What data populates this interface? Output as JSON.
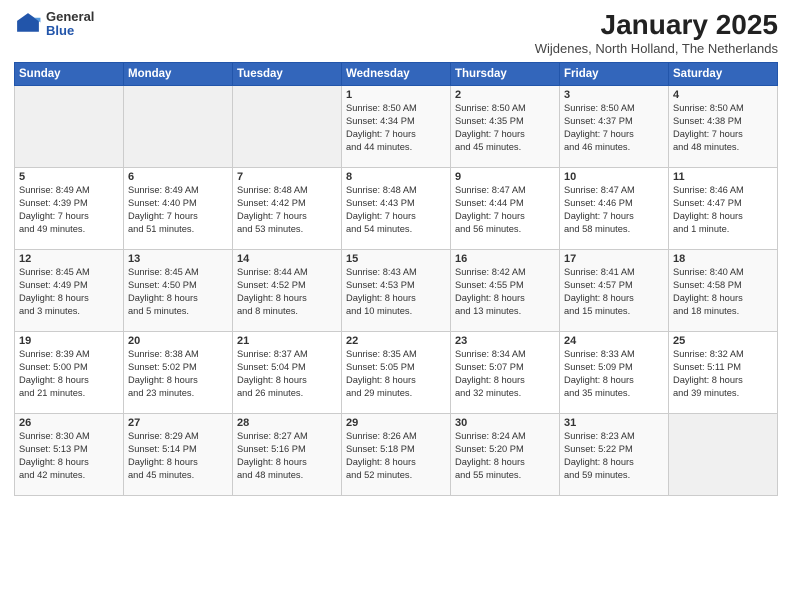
{
  "logo": {
    "general": "General",
    "blue": "Blue"
  },
  "title": "January 2025",
  "location": "Wijdenes, North Holland, The Netherlands",
  "weekdays": [
    "Sunday",
    "Monday",
    "Tuesday",
    "Wednesday",
    "Thursday",
    "Friday",
    "Saturday"
  ],
  "weeks": [
    [
      {
        "day": "",
        "info": ""
      },
      {
        "day": "",
        "info": ""
      },
      {
        "day": "",
        "info": ""
      },
      {
        "day": "1",
        "info": "Sunrise: 8:50 AM\nSunset: 4:34 PM\nDaylight: 7 hours\nand 44 minutes."
      },
      {
        "day": "2",
        "info": "Sunrise: 8:50 AM\nSunset: 4:35 PM\nDaylight: 7 hours\nand 45 minutes."
      },
      {
        "day": "3",
        "info": "Sunrise: 8:50 AM\nSunset: 4:37 PM\nDaylight: 7 hours\nand 46 minutes."
      },
      {
        "day": "4",
        "info": "Sunrise: 8:50 AM\nSunset: 4:38 PM\nDaylight: 7 hours\nand 48 minutes."
      }
    ],
    [
      {
        "day": "5",
        "info": "Sunrise: 8:49 AM\nSunset: 4:39 PM\nDaylight: 7 hours\nand 49 minutes."
      },
      {
        "day": "6",
        "info": "Sunrise: 8:49 AM\nSunset: 4:40 PM\nDaylight: 7 hours\nand 51 minutes."
      },
      {
        "day": "7",
        "info": "Sunrise: 8:48 AM\nSunset: 4:42 PM\nDaylight: 7 hours\nand 53 minutes."
      },
      {
        "day": "8",
        "info": "Sunrise: 8:48 AM\nSunset: 4:43 PM\nDaylight: 7 hours\nand 54 minutes."
      },
      {
        "day": "9",
        "info": "Sunrise: 8:47 AM\nSunset: 4:44 PM\nDaylight: 7 hours\nand 56 minutes."
      },
      {
        "day": "10",
        "info": "Sunrise: 8:47 AM\nSunset: 4:46 PM\nDaylight: 7 hours\nand 58 minutes."
      },
      {
        "day": "11",
        "info": "Sunrise: 8:46 AM\nSunset: 4:47 PM\nDaylight: 8 hours\nand 1 minute."
      }
    ],
    [
      {
        "day": "12",
        "info": "Sunrise: 8:45 AM\nSunset: 4:49 PM\nDaylight: 8 hours\nand 3 minutes."
      },
      {
        "day": "13",
        "info": "Sunrise: 8:45 AM\nSunset: 4:50 PM\nDaylight: 8 hours\nand 5 minutes."
      },
      {
        "day": "14",
        "info": "Sunrise: 8:44 AM\nSunset: 4:52 PM\nDaylight: 8 hours\nand 8 minutes."
      },
      {
        "day": "15",
        "info": "Sunrise: 8:43 AM\nSunset: 4:53 PM\nDaylight: 8 hours\nand 10 minutes."
      },
      {
        "day": "16",
        "info": "Sunrise: 8:42 AM\nSunset: 4:55 PM\nDaylight: 8 hours\nand 13 minutes."
      },
      {
        "day": "17",
        "info": "Sunrise: 8:41 AM\nSunset: 4:57 PM\nDaylight: 8 hours\nand 15 minutes."
      },
      {
        "day": "18",
        "info": "Sunrise: 8:40 AM\nSunset: 4:58 PM\nDaylight: 8 hours\nand 18 minutes."
      }
    ],
    [
      {
        "day": "19",
        "info": "Sunrise: 8:39 AM\nSunset: 5:00 PM\nDaylight: 8 hours\nand 21 minutes."
      },
      {
        "day": "20",
        "info": "Sunrise: 8:38 AM\nSunset: 5:02 PM\nDaylight: 8 hours\nand 23 minutes."
      },
      {
        "day": "21",
        "info": "Sunrise: 8:37 AM\nSunset: 5:04 PM\nDaylight: 8 hours\nand 26 minutes."
      },
      {
        "day": "22",
        "info": "Sunrise: 8:35 AM\nSunset: 5:05 PM\nDaylight: 8 hours\nand 29 minutes."
      },
      {
        "day": "23",
        "info": "Sunrise: 8:34 AM\nSunset: 5:07 PM\nDaylight: 8 hours\nand 32 minutes."
      },
      {
        "day": "24",
        "info": "Sunrise: 8:33 AM\nSunset: 5:09 PM\nDaylight: 8 hours\nand 35 minutes."
      },
      {
        "day": "25",
        "info": "Sunrise: 8:32 AM\nSunset: 5:11 PM\nDaylight: 8 hours\nand 39 minutes."
      }
    ],
    [
      {
        "day": "26",
        "info": "Sunrise: 8:30 AM\nSunset: 5:13 PM\nDaylight: 8 hours\nand 42 minutes."
      },
      {
        "day": "27",
        "info": "Sunrise: 8:29 AM\nSunset: 5:14 PM\nDaylight: 8 hours\nand 45 minutes."
      },
      {
        "day": "28",
        "info": "Sunrise: 8:27 AM\nSunset: 5:16 PM\nDaylight: 8 hours\nand 48 minutes."
      },
      {
        "day": "29",
        "info": "Sunrise: 8:26 AM\nSunset: 5:18 PM\nDaylight: 8 hours\nand 52 minutes."
      },
      {
        "day": "30",
        "info": "Sunrise: 8:24 AM\nSunset: 5:20 PM\nDaylight: 8 hours\nand 55 minutes."
      },
      {
        "day": "31",
        "info": "Sunrise: 8:23 AM\nSunset: 5:22 PM\nDaylight: 8 hours\nand 59 minutes."
      },
      {
        "day": "",
        "info": ""
      }
    ]
  ]
}
